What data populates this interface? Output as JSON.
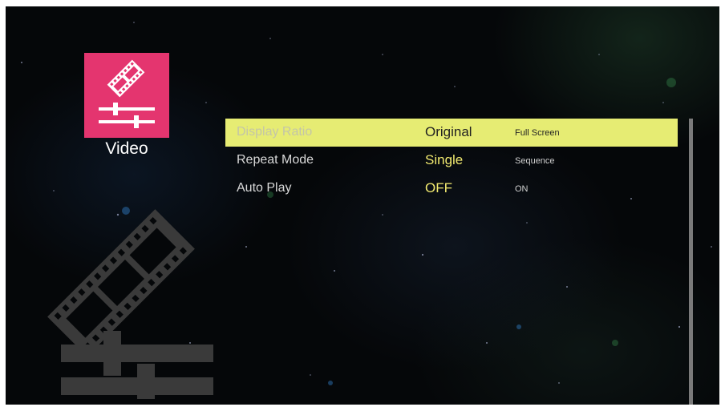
{
  "category": {
    "label": "Video",
    "icon": "film-strip-sliders-icon",
    "tile_color": "#e4356f"
  },
  "background_icon": "film-strip-sliders-icon",
  "settings": [
    {
      "name": "Display Ratio",
      "current": "Original",
      "alternate": "Full Screen",
      "selected": true
    },
    {
      "name": "Repeat Mode",
      "current": "Single",
      "alternate": "Sequence",
      "selected": false
    },
    {
      "name": "Auto Play",
      "current": "OFF",
      "alternate": "ON",
      "selected": false
    }
  ],
  "colors": {
    "highlight": "#e6ec73",
    "value_text": "#f1e96f"
  }
}
